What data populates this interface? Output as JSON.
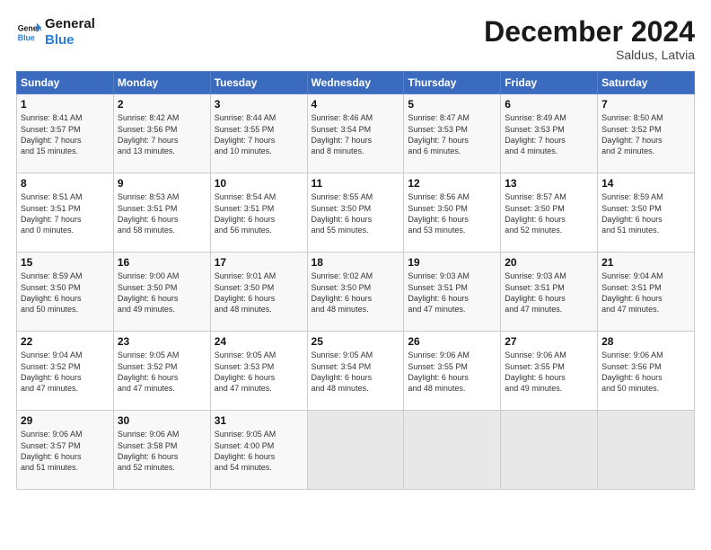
{
  "logo": {
    "line1": "General",
    "line2": "Blue"
  },
  "title": "December 2024",
  "subtitle": "Saldus, Latvia",
  "header_days": [
    "Sunday",
    "Monday",
    "Tuesday",
    "Wednesday",
    "Thursday",
    "Friday",
    "Saturday"
  ],
  "weeks": [
    [
      {
        "day": "1",
        "info": "Sunrise: 8:41 AM\nSunset: 3:57 PM\nDaylight: 7 hours\nand 15 minutes."
      },
      {
        "day": "2",
        "info": "Sunrise: 8:42 AM\nSunset: 3:56 PM\nDaylight: 7 hours\nand 13 minutes."
      },
      {
        "day": "3",
        "info": "Sunrise: 8:44 AM\nSunset: 3:55 PM\nDaylight: 7 hours\nand 10 minutes."
      },
      {
        "day": "4",
        "info": "Sunrise: 8:46 AM\nSunset: 3:54 PM\nDaylight: 7 hours\nand 8 minutes."
      },
      {
        "day": "5",
        "info": "Sunrise: 8:47 AM\nSunset: 3:53 PM\nDaylight: 7 hours\nand 6 minutes."
      },
      {
        "day": "6",
        "info": "Sunrise: 8:49 AM\nSunset: 3:53 PM\nDaylight: 7 hours\nand 4 minutes."
      },
      {
        "day": "7",
        "info": "Sunrise: 8:50 AM\nSunset: 3:52 PM\nDaylight: 7 hours\nand 2 minutes."
      }
    ],
    [
      {
        "day": "8",
        "info": "Sunrise: 8:51 AM\nSunset: 3:51 PM\nDaylight: 7 hours\nand 0 minutes."
      },
      {
        "day": "9",
        "info": "Sunrise: 8:53 AM\nSunset: 3:51 PM\nDaylight: 6 hours\nand 58 minutes."
      },
      {
        "day": "10",
        "info": "Sunrise: 8:54 AM\nSunset: 3:51 PM\nDaylight: 6 hours\nand 56 minutes."
      },
      {
        "day": "11",
        "info": "Sunrise: 8:55 AM\nSunset: 3:50 PM\nDaylight: 6 hours\nand 55 minutes."
      },
      {
        "day": "12",
        "info": "Sunrise: 8:56 AM\nSunset: 3:50 PM\nDaylight: 6 hours\nand 53 minutes."
      },
      {
        "day": "13",
        "info": "Sunrise: 8:57 AM\nSunset: 3:50 PM\nDaylight: 6 hours\nand 52 minutes."
      },
      {
        "day": "14",
        "info": "Sunrise: 8:59 AM\nSunset: 3:50 PM\nDaylight: 6 hours\nand 51 minutes."
      }
    ],
    [
      {
        "day": "15",
        "info": "Sunrise: 8:59 AM\nSunset: 3:50 PM\nDaylight: 6 hours\nand 50 minutes."
      },
      {
        "day": "16",
        "info": "Sunrise: 9:00 AM\nSunset: 3:50 PM\nDaylight: 6 hours\nand 49 minutes."
      },
      {
        "day": "17",
        "info": "Sunrise: 9:01 AM\nSunset: 3:50 PM\nDaylight: 6 hours\nand 48 minutes."
      },
      {
        "day": "18",
        "info": "Sunrise: 9:02 AM\nSunset: 3:50 PM\nDaylight: 6 hours\nand 48 minutes."
      },
      {
        "day": "19",
        "info": "Sunrise: 9:03 AM\nSunset: 3:51 PM\nDaylight: 6 hours\nand 47 minutes."
      },
      {
        "day": "20",
        "info": "Sunrise: 9:03 AM\nSunset: 3:51 PM\nDaylight: 6 hours\nand 47 minutes."
      },
      {
        "day": "21",
        "info": "Sunrise: 9:04 AM\nSunset: 3:51 PM\nDaylight: 6 hours\nand 47 minutes."
      }
    ],
    [
      {
        "day": "22",
        "info": "Sunrise: 9:04 AM\nSunset: 3:52 PM\nDaylight: 6 hours\nand 47 minutes."
      },
      {
        "day": "23",
        "info": "Sunrise: 9:05 AM\nSunset: 3:52 PM\nDaylight: 6 hours\nand 47 minutes."
      },
      {
        "day": "24",
        "info": "Sunrise: 9:05 AM\nSunset: 3:53 PM\nDaylight: 6 hours\nand 47 minutes."
      },
      {
        "day": "25",
        "info": "Sunrise: 9:05 AM\nSunset: 3:54 PM\nDaylight: 6 hours\nand 48 minutes."
      },
      {
        "day": "26",
        "info": "Sunrise: 9:06 AM\nSunset: 3:55 PM\nDaylight: 6 hours\nand 48 minutes."
      },
      {
        "day": "27",
        "info": "Sunrise: 9:06 AM\nSunset: 3:55 PM\nDaylight: 6 hours\nand 49 minutes."
      },
      {
        "day": "28",
        "info": "Sunrise: 9:06 AM\nSunset: 3:56 PM\nDaylight: 6 hours\nand 50 minutes."
      }
    ],
    [
      {
        "day": "29",
        "info": "Sunrise: 9:06 AM\nSunset: 3:57 PM\nDaylight: 6 hours\nand 51 minutes."
      },
      {
        "day": "30",
        "info": "Sunrise: 9:06 AM\nSunset: 3:58 PM\nDaylight: 6 hours\nand 52 minutes."
      },
      {
        "day": "31",
        "info": "Sunrise: 9:05 AM\nSunset: 4:00 PM\nDaylight: 6 hours\nand 54 minutes."
      },
      {
        "day": "",
        "info": ""
      },
      {
        "day": "",
        "info": ""
      },
      {
        "day": "",
        "info": ""
      },
      {
        "day": "",
        "info": ""
      }
    ]
  ]
}
